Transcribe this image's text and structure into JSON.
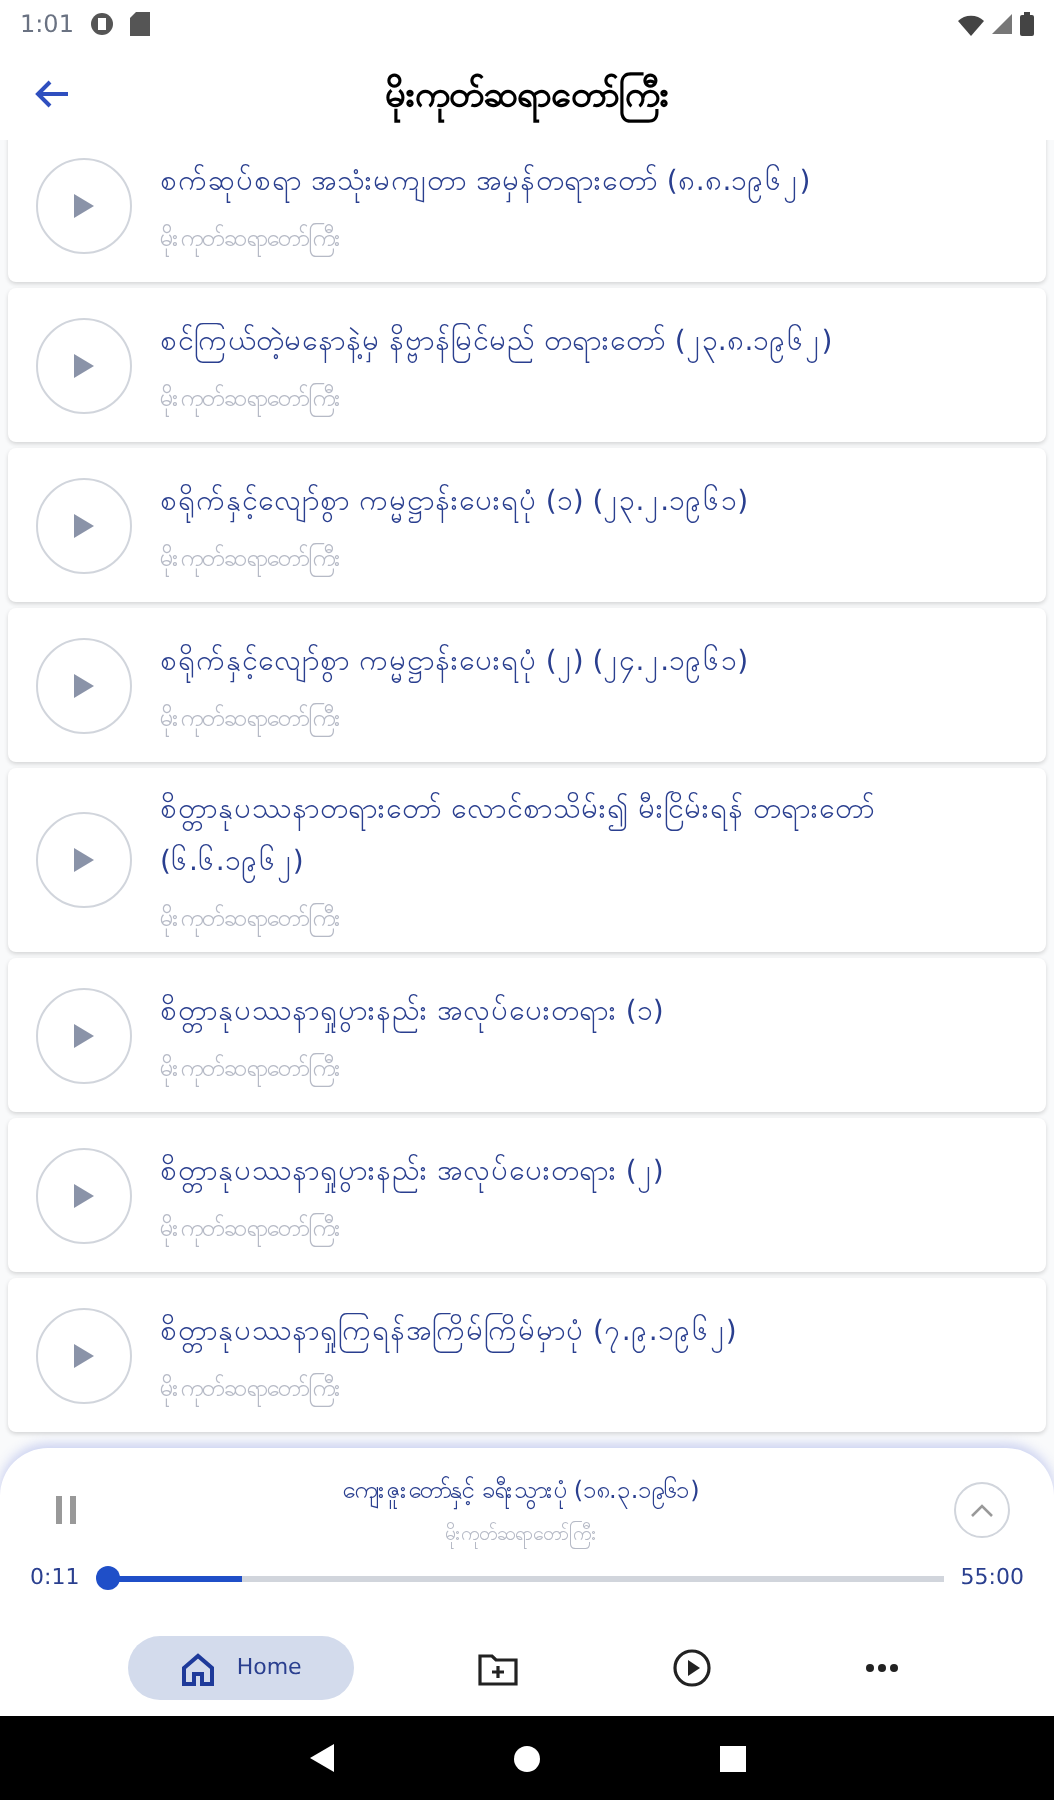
{
  "status_bar": {
    "time": "1:01"
  },
  "header": {
    "title": "မိုးကုတ်ဆရာတော်ကြီး"
  },
  "tracks": [
    {
      "title": "စက်ဆုပ်စရာ အသုံးမကျတာ အမှန်တရားတော် (၈.၈.၁၉၆၂)",
      "speaker": "မိုးကုတ်ဆရာတော်ကြီး"
    },
    {
      "title": "စင်ကြယ်တဲ့မနောနဲ့မှ နိဗ္ဗာန်မြင်မည် တရားတော် (၂၃.၈.၁၉၆၂)",
      "speaker": "မိုးကုတ်ဆရာတော်ကြီး"
    },
    {
      "title": "စရိုက်နှင့်လျော်စွာ ကမ္မဋ္ဌာန်းပေးရပုံ (၁) (၂၃.၂.၁၉၆၁)",
      "speaker": "မိုးကုတ်ဆရာတော်ကြီး"
    },
    {
      "title": "စရိုက်နှင့်လျော်စွာ ကမ္မဋ္ဌာန်းပေးရပုံ (၂) (၂၄.၂.၁၉၆၁)",
      "speaker": "မိုးကုတ်ဆရာတော်ကြီး"
    },
    {
      "title": "စိတ္တာနုပဿနာတရားတော် လောင်စာသိမ်း၍ မီးငြိမ်းရန် တရားတော် (၆.၆.၁၉၆၂)",
      "speaker": "မိုးကုတ်ဆရာတော်ကြီး"
    },
    {
      "title": "စိတ္တာနုပဿနာရှုပွားနည်း အလုပ်ပေးတရား (၁)",
      "speaker": "မိုးကုတ်ဆရာတော်ကြီး"
    },
    {
      "title": "စိတ္တာနုပဿနာရှုပွားနည်း အလုပ်ပေးတရား (၂)",
      "speaker": "မိုးကုတ်ဆရာတော်ကြီး"
    },
    {
      "title": "စိတ္တာနုပဿနာရှုကြရန်အကြိမ်ကြိမ်မှာပုံ (၇.၉.၁၉၆၂)",
      "speaker": "မိုးကုတ်ဆရာတော်ကြီး"
    }
  ],
  "player": {
    "title": "ကျေးဇူးတော်နှင့် ခရီးသွားပုံ (၁၈.၃.၁၉၆၁)",
    "speaker": "မိုးကုတ်ဆရာတော်ကြီး",
    "elapsed": "0:11",
    "duration": "55:00",
    "playing": true,
    "level": 0.16
  },
  "bottom_nav": [
    {
      "kind": "home",
      "label": "Home",
      "selected": true
    },
    {
      "kind": "folder",
      "selected": false
    },
    {
      "kind": "play",
      "selected": false
    },
    {
      "kind": "more",
      "selected": false
    }
  ]
}
